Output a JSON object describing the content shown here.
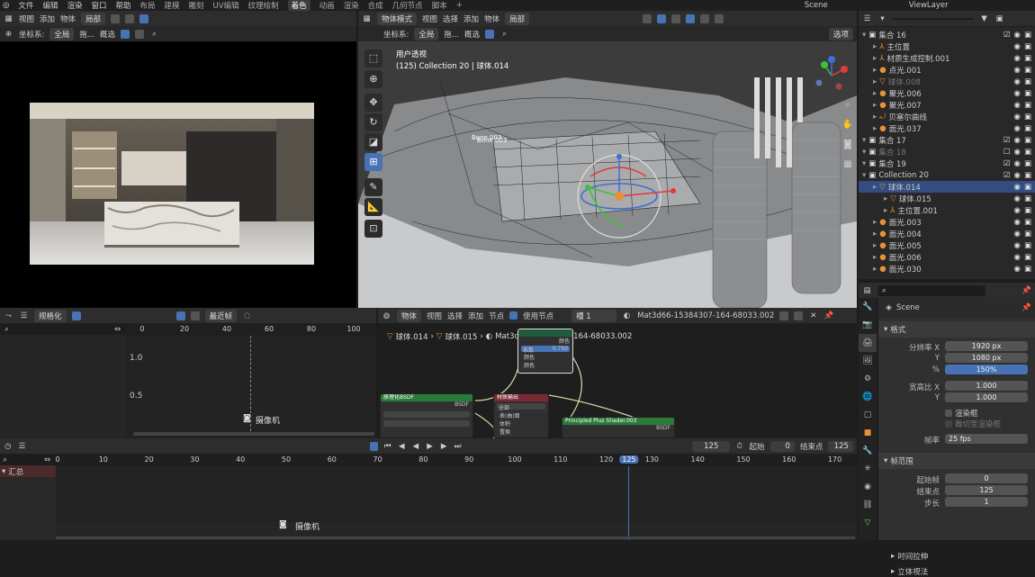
{
  "topbar": {
    "menus": [
      "文件",
      "编辑",
      "渲染",
      "窗口",
      "帮助"
    ],
    "workspaces": [
      "布局",
      "建模",
      "雕刻",
      "UV编辑",
      "纹理绘制",
      "着色",
      "动画",
      "渲染",
      "合成",
      "几何节点",
      "脚本"
    ],
    "active_workspace": "着色",
    "add_tab": "+",
    "scene": "Scene",
    "view_layer": "ViewLayer"
  },
  "image_editor": {
    "header_menus": [
      "视图",
      "添加",
      "物体"
    ],
    "mode": "局部",
    "coord_label": "坐标系:",
    "coord_value": "全局",
    "drag_label": "拖...",
    "snap_label": "概选"
  },
  "viewport": {
    "mode": "物体模式",
    "menus": [
      "视图",
      "选择",
      "添加",
      "物体"
    ],
    "pivot": "局部",
    "coord_label": "坐标系:",
    "coord_value": "全局",
    "drag_label": "拖...",
    "select_label": "概选",
    "options_label": "选项",
    "view_name": "用户透视",
    "object_info": "(125) Collection 20 | 球体.014",
    "bone_label": "Bone.003",
    "bone_label2": "Bone.003",
    "gizmo_x": "X",
    "gizmo_y": "Y",
    "gizmo_z": "Z"
  },
  "outliner": {
    "search_placeholder": "",
    "rows": [
      {
        "label": "集合 16",
        "indent": 0,
        "icon": "collection",
        "check": true,
        "state": "normal"
      },
      {
        "label": "主位置",
        "indent": 1,
        "icon": "empty",
        "check": false,
        "state": "normal"
      },
      {
        "label": "材质生成控制.001",
        "indent": 1,
        "icon": "empty",
        "check": false,
        "state": "normal"
      },
      {
        "label": "点光.001",
        "indent": 1,
        "icon": "light",
        "check": false,
        "state": "normal"
      },
      {
        "label": "球体.008",
        "indent": 1,
        "icon": "mesh",
        "check": false,
        "state": "dim"
      },
      {
        "label": "聚光.006",
        "indent": 1,
        "icon": "light",
        "check": false,
        "state": "normal"
      },
      {
        "label": "聚光.007",
        "indent": 1,
        "icon": "light",
        "check": false,
        "state": "normal"
      },
      {
        "label": "贝塞尔曲线",
        "indent": 1,
        "icon": "curve",
        "check": false,
        "state": "normal"
      },
      {
        "label": "面光.037",
        "indent": 1,
        "icon": "light",
        "check": false,
        "state": "normal"
      },
      {
        "label": "集合 17",
        "indent": 0,
        "icon": "collection",
        "check": true,
        "state": "normal"
      },
      {
        "label": "集合 18",
        "indent": 0,
        "icon": "collection",
        "check": false,
        "state": "dim"
      },
      {
        "label": "集合 19",
        "indent": 0,
        "icon": "collection",
        "check": true,
        "state": "normal"
      },
      {
        "label": "Collection 20",
        "indent": 0,
        "icon": "collection",
        "check": true,
        "state": "normal"
      },
      {
        "label": "球体.014",
        "indent": 1,
        "icon": "mesh",
        "check": false,
        "state": "selected"
      },
      {
        "label": "球体.015",
        "indent": 2,
        "icon": "mesh",
        "check": false,
        "state": "normal"
      },
      {
        "label": "主位置.001",
        "indent": 2,
        "icon": "empty",
        "check": false,
        "state": "normal"
      },
      {
        "label": "面光.003",
        "indent": 1,
        "icon": "light",
        "check": false,
        "state": "normal"
      },
      {
        "label": "面光.004",
        "indent": 1,
        "icon": "light",
        "check": false,
        "state": "normal"
      },
      {
        "label": "面光.005",
        "indent": 1,
        "icon": "light",
        "check": false,
        "state": "normal"
      },
      {
        "label": "面光.006",
        "indent": 1,
        "icon": "light",
        "check": false,
        "state": "normal"
      },
      {
        "label": "面光.030",
        "indent": 1,
        "icon": "light",
        "check": false,
        "state": "normal"
      }
    ]
  },
  "properties": {
    "scene_name": "Scene",
    "format_title": "格式",
    "res_x_label": "分辨率 X",
    "res_x": "1920 px",
    "res_y_label": "Y",
    "res_y": "1080 px",
    "res_pct_label": "%",
    "res_pct": "150%",
    "aspect_x_label": "宽高比 X",
    "aspect_x": "1.000",
    "aspect_y_label": "Y",
    "aspect_y": "1.000",
    "render_region": "渲染框",
    "crop_region": "裁切至渲染框",
    "fps_label": "帧率",
    "fps": "25 fps",
    "frame_range_title": "帧范围",
    "start_label": "起始帧",
    "start": "0",
    "end_label": "结束点",
    "end": "125",
    "step_label": "步长",
    "step": "1",
    "time_stretch": "时间拉伸",
    "stereo": "立体视法"
  },
  "graph_editor": {
    "normalize": "规格化",
    "nearest_frame": "最近帧",
    "x_ticks": [
      "0",
      "20",
      "40",
      "60",
      "80",
      "100"
    ],
    "y_ticks": [
      "1.0",
      "0.5"
    ],
    "camera_label": "摄像机"
  },
  "node_editor": {
    "mode": "物体",
    "menus": [
      "视图",
      "选择",
      "添加",
      "节点"
    ],
    "use_nodes": "使用节点",
    "slot": "槽 1",
    "material": "Mat3d66-15384307-164-68033.002",
    "breadcrumb": [
      "球体.014",
      "球体.015",
      "Mat3d66-15384307-164-68033.002"
    ],
    "node1_title": "原理化BSDF",
    "node1_out": "BSDF",
    "node2_title": "材质输出",
    "node2_target": "全部",
    "node2_in": [
      "表(曲)面",
      "体积",
      "置换"
    ],
    "node3_title": "Principled Plus Shader.003",
    "node3_out": "BSDF",
    "node4_out": [
      "颜色",
      "颜色",
      "颜色"
    ],
    "node4_value": "0.750",
    "node4_label": "系数"
  },
  "timeline": {
    "current_frame": "125",
    "start_label": "起始",
    "start": "0",
    "end_label": "结束点",
    "end": "125",
    "ticks": [
      "0",
      "10",
      "20",
      "30",
      "40",
      "50",
      "60",
      "70",
      "80",
      "90",
      "100",
      "110",
      "120",
      "125",
      "130",
      "140",
      "150",
      "160",
      "170"
    ],
    "summary": "汇总",
    "camera_label": "摄像机"
  },
  "colors": {
    "accent": "#4772b3",
    "selected_row": "#334d80",
    "playhead": "#4772b3",
    "object_orange": "#e8913a",
    "data_green": "#6bd16b"
  }
}
